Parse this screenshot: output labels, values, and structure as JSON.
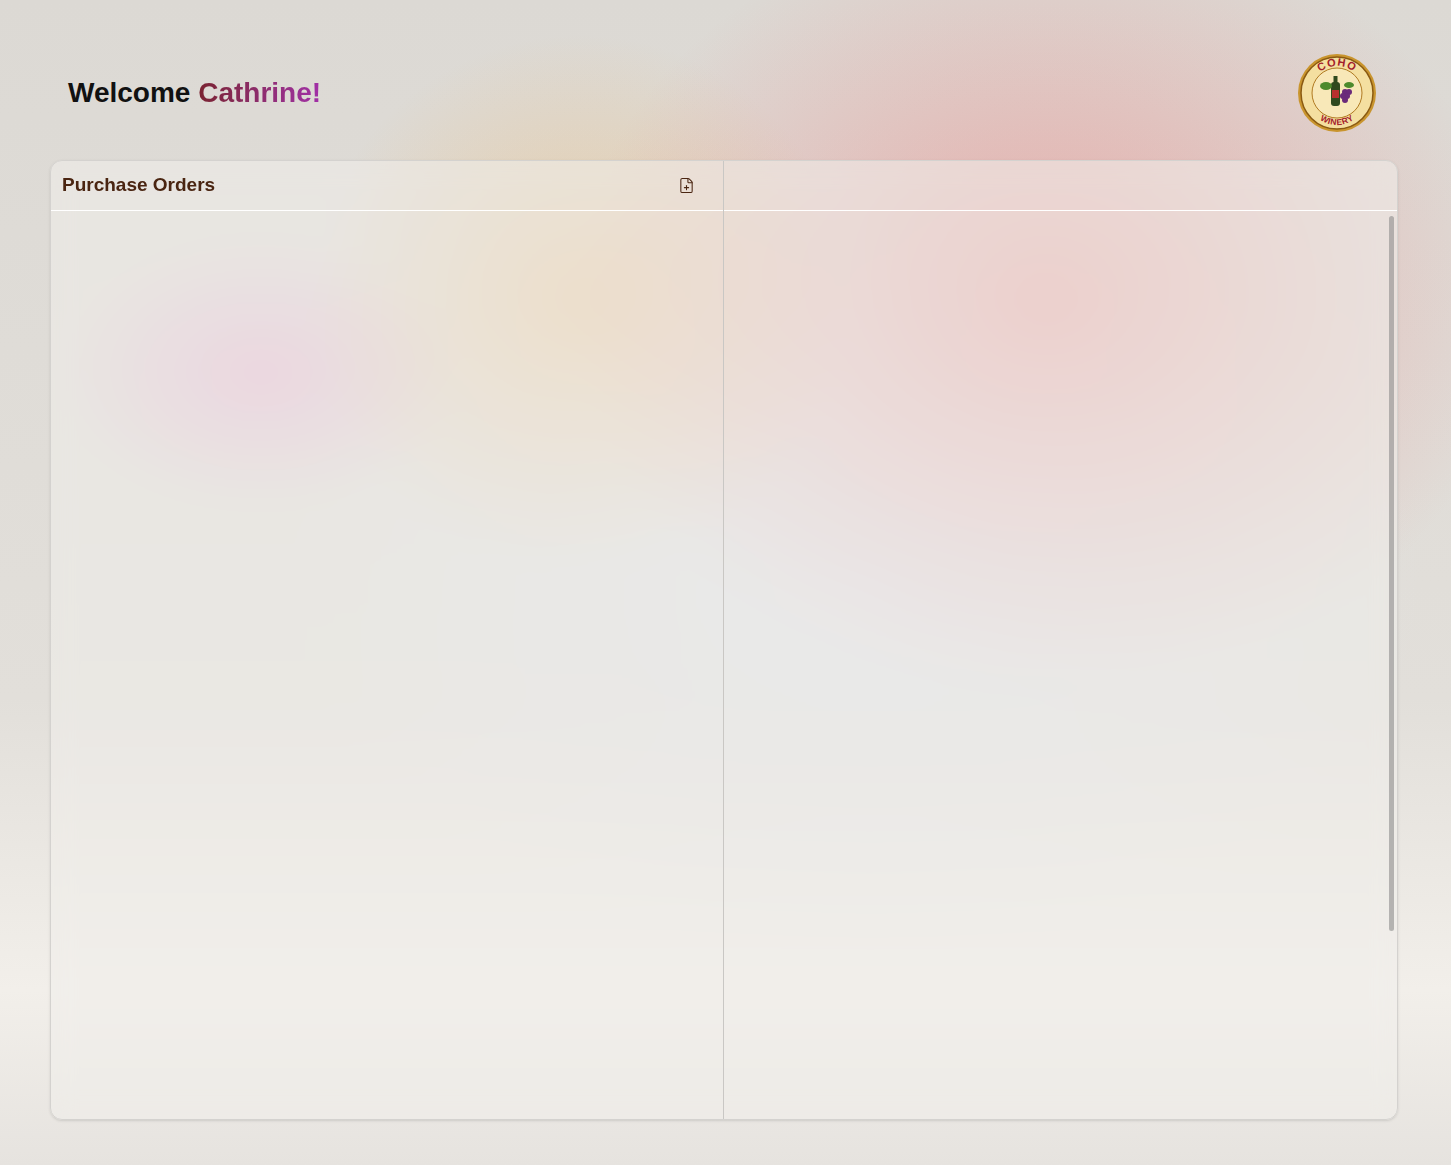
{
  "header": {
    "greeting": "Welcome",
    "user_name": "Cathrine!"
  },
  "logo": {
    "top": "COHO",
    "bottom": "WINERY"
  },
  "purchase_orders": {
    "title": "Purchase Orders"
  }
}
